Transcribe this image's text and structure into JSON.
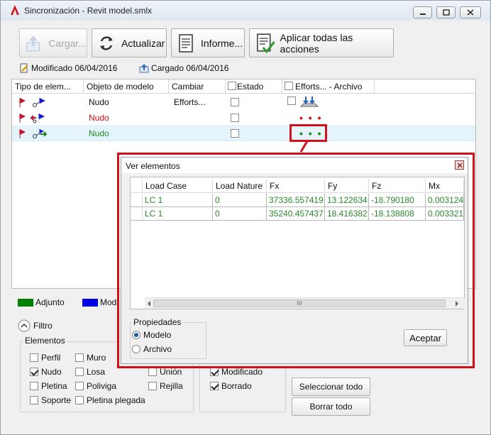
{
  "window": {
    "title": "Sincronización - Revit model.smlx"
  },
  "toolbar": {
    "cargar": "Cargar...",
    "actualizar": "Actualizar",
    "informe": "Informe...",
    "aplicar": "Aplicar todas las acciones"
  },
  "status": {
    "modificado": "Modificado 06/04/2016",
    "cargado": "Cargado 06/04/2016"
  },
  "grid": {
    "headers": [
      "Tipo de elem...",
      "Objeto de modelo",
      "Cambiar",
      "Estado",
      "Efforts... - Archivo"
    ],
    "rows": [
      {
        "objeto": "Nudo",
        "cambiar": "Efforts...",
        "color": "#1a1ad0"
      },
      {
        "objeto": "Nudo",
        "cambiar": "",
        "color": "#d0101a"
      },
      {
        "objeto": "Nudo",
        "cambiar": "",
        "color": "#1e8a1e"
      }
    ],
    "dots": "• • •"
  },
  "legend": {
    "adjunto": "Adjunto",
    "modificado": "Mod"
  },
  "filtro": {
    "label": "Filtro"
  },
  "elementos": {
    "title": "Elementos",
    "items": [
      {
        "label": "Perfil",
        "checked": false
      },
      {
        "label": "Muro",
        "checked": false
      },
      {
        "label": "Nudo",
        "checked": true
      },
      {
        "label": "Losa",
        "checked": false
      },
      {
        "label": "Unión",
        "checked": false
      },
      {
        "label": "Pletina",
        "checked": false
      },
      {
        "label": "Poliviga",
        "checked": false
      },
      {
        "label": "Rejilla",
        "checked": false
      },
      {
        "label": "Soporte",
        "checked": false
      },
      {
        "label": "Pletina plegada",
        "checked": false
      }
    ]
  },
  "estados": {
    "items": [
      {
        "label": "Modificado",
        "checked": true
      },
      {
        "label": "Borrado",
        "checked": true
      }
    ]
  },
  "buttons": {
    "seleccionar": "Seleccionar todo",
    "borrar": "Borrar todo"
  },
  "dialog": {
    "title": "Ver elementos",
    "columns": [
      "Load Case",
      "Load Nature",
      "Fx",
      "Fy",
      "Fz",
      "Mx"
    ],
    "rows": [
      [
        "LC 1",
        "0",
        "37336.557419",
        "13.122634",
        "-18.790180",
        "0.003124"
      ],
      [
        "LC 1",
        "0",
        "35240.457437",
        "18.416382",
        "-18.138808",
        "0.003321"
      ]
    ],
    "scroll_grip": "III",
    "propiedades": {
      "title": "Propiedades",
      "options": [
        {
          "label": "Modelo",
          "selected": true
        },
        {
          "label": "Archivo",
          "selected": false
        }
      ]
    },
    "aceptar": "Aceptar"
  },
  "colors": {
    "adjunto": "#008000",
    "modificado": "#0000e0",
    "highlight": "#d0101a",
    "green_text": "#2a8a2a"
  }
}
